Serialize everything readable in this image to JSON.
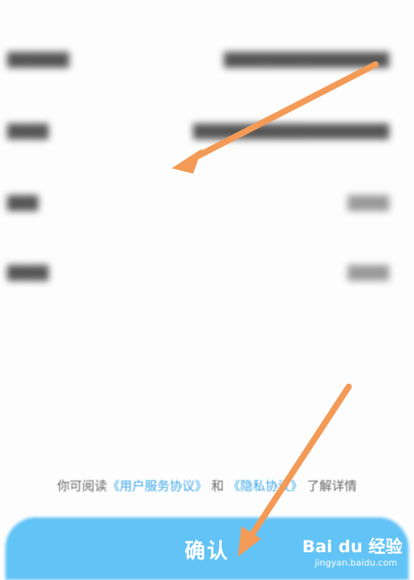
{
  "agreement": {
    "prefix": "你可阅读",
    "user_agreement": "《用户服务协议》",
    "conjunction": "和",
    "privacy_policy": "《隐私协议》",
    "suffix": "了解详情"
  },
  "confirm_label": "确认",
  "watermark": {
    "logo": "Bai du 经验",
    "url": "jingyan.baidu.com"
  },
  "colors": {
    "confirm_bar": "#62c3f6",
    "link": "#3aa7e8",
    "arrow": "#f39a56"
  }
}
